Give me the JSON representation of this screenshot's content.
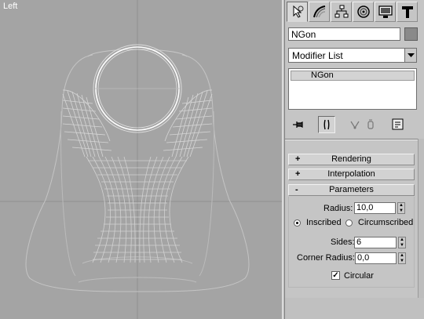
{
  "viewport": {
    "label": "Left"
  },
  "command_panel": {
    "tabs": [
      {
        "name": "create",
        "icon": "create-pointer-icon"
      },
      {
        "name": "modify",
        "icon": "modify-bend-icon"
      },
      {
        "name": "hierarchy",
        "icon": "hierarchy-icon"
      },
      {
        "name": "motion",
        "icon": "motion-icon"
      },
      {
        "name": "display",
        "icon": "display-monitor-icon"
      },
      {
        "name": "utilities",
        "icon": "utilities-hammer-icon"
      }
    ],
    "object_name": "NGon",
    "modifier_list_label": "Modifier List",
    "stack_items": [
      "NGon"
    ],
    "stack_toolbar": [
      "pin-stack-icon",
      "show-end-result-icon",
      "make-unique-icon",
      "remove-modifier-icon",
      "configure-sets-icon"
    ]
  },
  "rollouts": {
    "rendering": {
      "sign": "+",
      "title": "Rendering"
    },
    "interpolation": {
      "sign": "+",
      "title": "Interpolation"
    },
    "parameters": {
      "sign": "-",
      "title": "Parameters"
    }
  },
  "parameters": {
    "radius_label": "Radius:",
    "radius_value": "10,0",
    "inscribed_label": "Inscribed",
    "circumscribed_label": "Circumscribed",
    "inscribed_selected": true,
    "sides_label": "Sides:",
    "sides_value": "6",
    "corner_radius_label": "Corner Radius:",
    "corner_radius_value": "0,0",
    "circular_label": "Circular",
    "circular_checked": true
  }
}
